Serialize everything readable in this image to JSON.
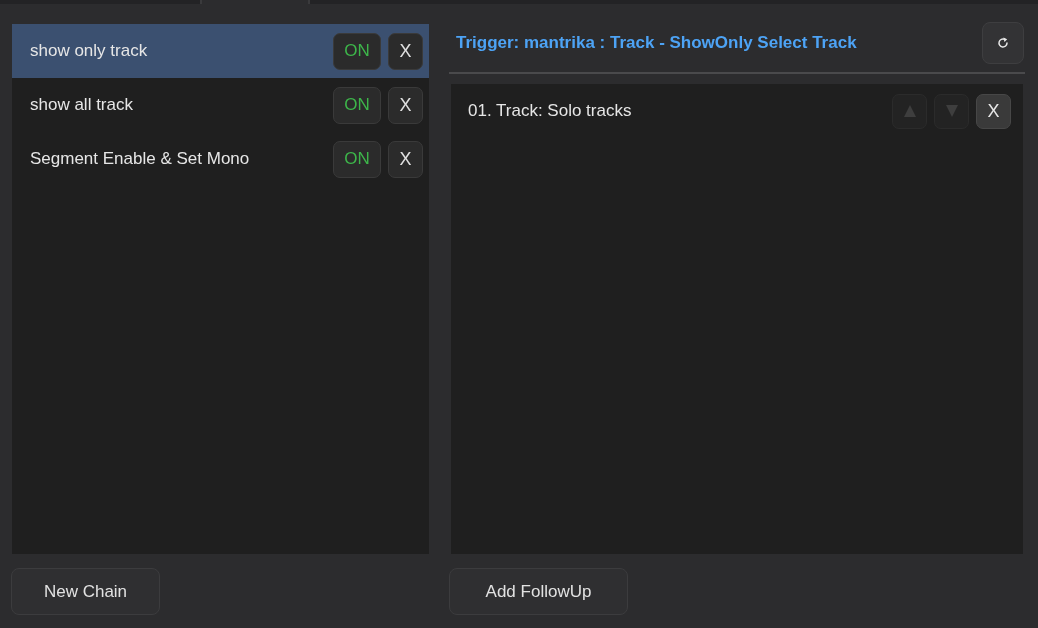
{
  "chains": [
    {
      "name": "show only track",
      "selected": true,
      "toggle_label": "ON",
      "on": true,
      "remove_label": "X"
    },
    {
      "name": "show all track",
      "selected": false,
      "toggle_label": "ON",
      "on": true,
      "remove_label": "X"
    },
    {
      "name": "Segment Enable & Set Mono",
      "selected": false,
      "toggle_label": "ON",
      "on": true,
      "remove_label": "X"
    }
  ],
  "new_chain_button": "New Chain",
  "trigger_header": {
    "title": "Trigger: mantrika : Track - ShowOnly Select Track"
  },
  "followups": [
    {
      "label": "01. Track: Solo tracks",
      "move_up_disabled": true,
      "move_down_disabled": true,
      "remove_label": "X"
    }
  ],
  "add_followup_button": "Add FollowUp"
}
